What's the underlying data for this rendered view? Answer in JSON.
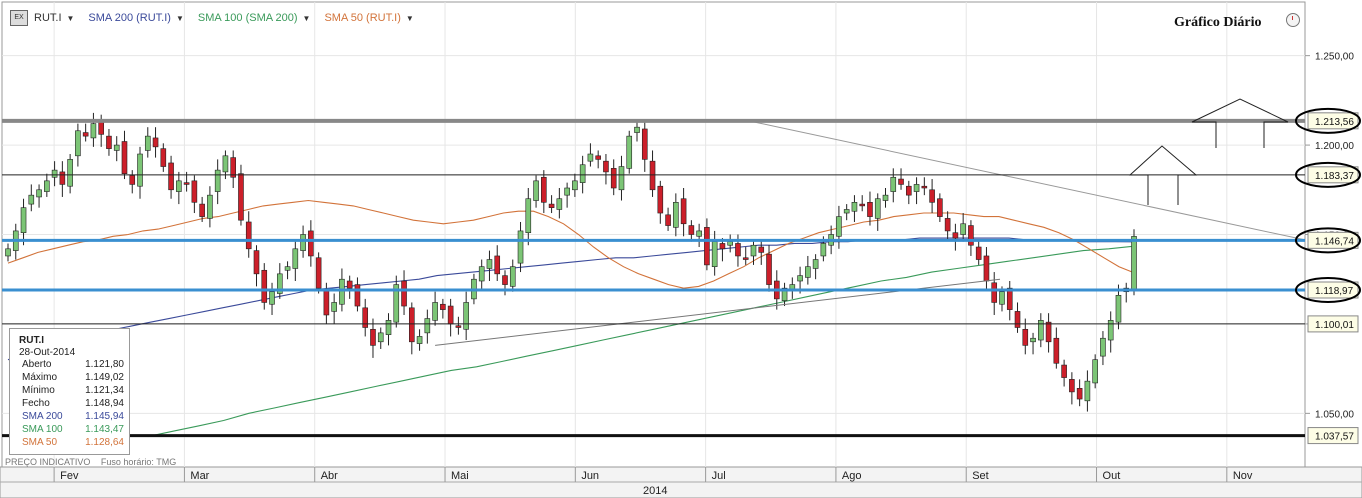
{
  "toolbar": {
    "symbol": "RUT.I",
    "sma200": {
      "label": "SMA 200 (RUT.I)",
      "color": "#3b4a9a"
    },
    "sma100": {
      "label": "SMA 100 (SMA 200)",
      "color": "#3a9a5a"
    },
    "sma50": {
      "label": "SMA 50 (RUT.I)",
      "color": "#d2733a"
    }
  },
  "title": "Gráfico Diário",
  "info": {
    "symbol": "RUT.I",
    "date": "28-Out-2014",
    "rows": [
      {
        "label": "Aberto",
        "value": "1.121,80"
      },
      {
        "label": "Máximo",
        "value": "1.149,02"
      },
      {
        "label": "Mínimo",
        "value": "1.121,34"
      },
      {
        "label": "Fecho",
        "value": "1.148,94"
      },
      {
        "label": "SMA 200",
        "value": "1.145,94"
      },
      {
        "label": "SMA 100",
        "value": "1.143,47"
      },
      {
        "label": "SMA 50",
        "value": "1.128,64"
      }
    ]
  },
  "footer": {
    "note": "PREÇO INDICATIVO",
    "timezone": "Fuso horário: TMG"
  },
  "year_label": "2014",
  "chart_data": {
    "type": "candlestick",
    "y_axis": {
      "ticks": [
        1050,
        1100,
        1150,
        1200,
        1250
      ],
      "tick_labels": [
        "1.050,00",
        "1.100,00",
        "1.150,00",
        "1.200,00",
        "1.250,00"
      ],
      "range": [
        1020,
        1280
      ]
    },
    "x_labels": [
      "Fev",
      "Mar",
      "Abr",
      "Mai",
      "Jun",
      "Jul",
      "Ago",
      "Set",
      "Out",
      "Nov"
    ],
    "levels": [
      {
        "value": 1213.56,
        "label": "1.213,56",
        "style": "thick-gray",
        "circled": true
      },
      {
        "value": 1183.37,
        "label": "1.183,37",
        "style": "thin-black",
        "circled": true
      },
      {
        "value": 1146.74,
        "label": "1.146,74",
        "style": "blue",
        "circled": true
      },
      {
        "value": 1118.97,
        "label": "1.118,97",
        "style": "blue",
        "circled": true
      },
      {
        "value": 1100.01,
        "label": "1.100,01",
        "style": "thin-black",
        "circled": false
      },
      {
        "value": 1037.57,
        "label": "1.037,57",
        "style": "thick-black",
        "circled": false
      }
    ],
    "closes": [
      1142,
      1152,
      1165,
      1172,
      1175,
      1180,
      1186,
      1178,
      1192,
      1208,
      1205,
      1212,
      1206,
      1198,
      1200,
      1184,
      1178,
      1195,
      1205,
      1199,
      1188,
      1175,
      1180,
      1178,
      1168,
      1160,
      1172,
      1186,
      1194,
      1182,
      1158,
      1142,
      1128,
      1112,
      1118,
      1128,
      1132,
      1142,
      1150,
      1138,
      1120,
      1105,
      1112,
      1125,
      1120,
      1110,
      1098,
      1088,
      1095,
      1102,
      1122,
      1110,
      1090,
      1093,
      1103,
      1112,
      1108,
      1100,
      1098,
      1112,
      1125,
      1132,
      1136,
      1128,
      1122,
      1132,
      1152,
      1170,
      1180,
      1168,
      1165,
      1170,
      1176,
      1180,
      1189,
      1195,
      1192,
      1185,
      1176,
      1188,
      1205,
      1210,
      1192,
      1175,
      1162,
      1155,
      1168,
      1156,
      1150,
      1152,
      1133,
      1146,
      1142,
      1146,
      1138,
      1136,
      1144,
      1140,
      1122,
      1114,
      1120,
      1122,
      1127,
      1132,
      1136,
      1145,
      1150,
      1160,
      1164,
      1168,
      1166,
      1160,
      1170,
      1172,
      1182,
      1178,
      1172,
      1178,
      1176,
      1168,
      1160,
      1152,
      1148,
      1156,
      1144,
      1136,
      1124,
      1112,
      1118,
      1108,
      1098,
      1088,
      1092,
      1102,
      1090,
      1078,
      1070,
      1062,
      1058,
      1068,
      1080,
      1092,
      1102,
      1116,
      1120,
      1148.94
    ],
    "sma50": [
      1134,
      1137,
      1140,
      1142,
      1144,
      1146,
      1147,
      1149,
      1150,
      1152,
      1153,
      1155,
      1157,
      1159,
      1160,
      1162,
      1164,
      1166,
      1167,
      1168,
      1169,
      1168,
      1167,
      1166,
      1164,
      1162,
      1160,
      1158,
      1157,
      1156,
      1157,
      1158,
      1160,
      1162,
      1163,
      1163,
      1160,
      1156,
      1150,
      1143,
      1137,
      1132,
      1128,
      1125,
      1122,
      1120,
      1121,
      1124,
      1128,
      1132,
      1137,
      1141,
      1145,
      1148,
      1151,
      1153,
      1155,
      1157,
      1158,
      1160,
      1161,
      1162,
      1162,
      1162,
      1161,
      1160,
      1160,
      1158,
      1156,
      1154,
      1151,
      1147,
      1142,
      1137,
      1132,
      1128.64
    ],
    "sma200": [
      1080,
      1083,
      1086,
      1089,
      1092,
      1095,
      1097,
      1099,
      1101,
      1103,
      1105,
      1107,
      1109,
      1111,
      1113,
      1115,
      1117,
      1119,
      1120,
      1121,
      1122,
      1123,
      1124,
      1125,
      1127,
      1128,
      1129,
      1130,
      1131,
      1132,
      1133,
      1134,
      1135,
      1136,
      1137,
      1137,
      1138,
      1139,
      1140,
      1141,
      1142,
      1143,
      1144,
      1144,
      1145,
      1145,
      1146,
      1146,
      1147,
      1147,
      1147,
      1148,
      1148,
      1148,
      1148,
      1148,
      1148,
      1147,
      1147,
      1147,
      1146,
      1146,
      1146,
      1145.94
    ],
    "sma100": [
      1037,
      1040,
      1043,
      1046,
      1050,
      1053,
      1056,
      1059,
      1062,
      1065,
      1068,
      1071,
      1074,
      1076,
      1079,
      1082,
      1085,
      1088,
      1091,
      1094,
      1097,
      1100,
      1103,
      1106,
      1109,
      1112,
      1115,
      1118,
      1121,
      1124,
      1126,
      1129,
      1131,
      1133,
      1135,
      1137,
      1139,
      1141,
      1142,
      1143.47
    ]
  }
}
